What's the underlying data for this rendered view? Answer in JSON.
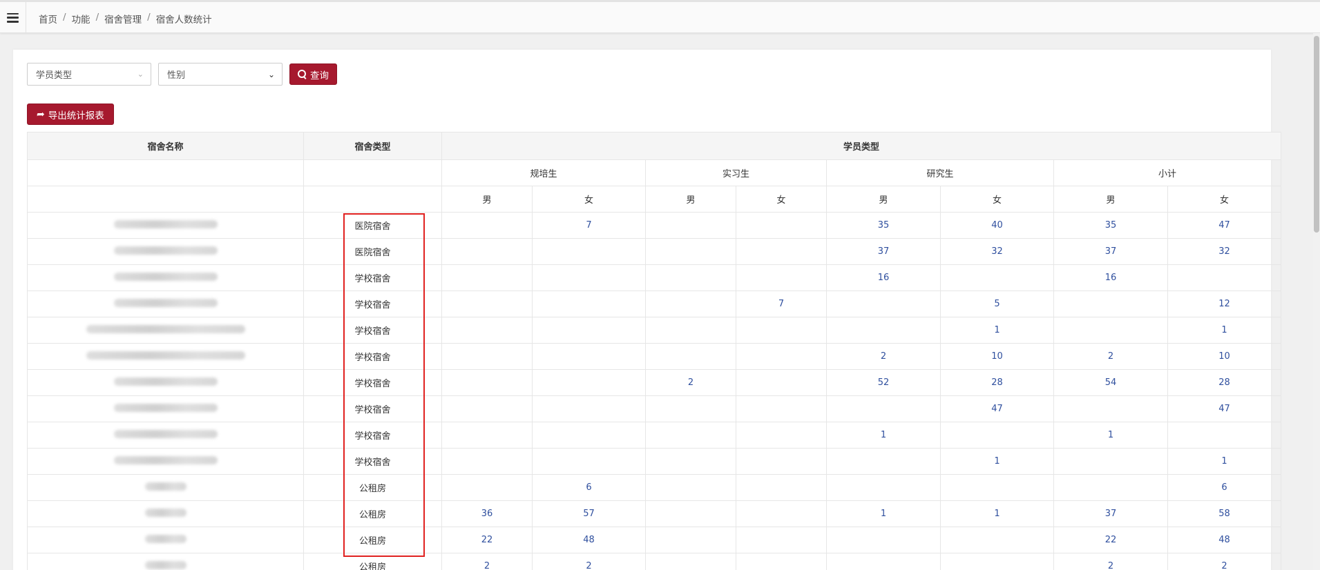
{
  "breadcrumb": [
    "首页",
    "功能",
    "宿舍管理",
    "宿舍人数统计"
  ],
  "filters": {
    "student_type_placeholder": "学员类型",
    "gender_placeholder": "性别",
    "search_label": "查询"
  },
  "export_label": "导出统计报表",
  "table": {
    "header": {
      "name": "宿舍名称",
      "dtype": "宿舍类型",
      "student_type": "学员类型"
    },
    "groups": [
      "规培生",
      "实习生",
      "研究生",
      "小计"
    ],
    "subcols": [
      "男",
      "女",
      "男",
      "女",
      "男",
      "女",
      "男",
      "女"
    ],
    "rows": [
      {
        "type": "医院宿舍",
        "v": [
          "",
          "7",
          "",
          "",
          "35",
          "40",
          "35",
          "47"
        ]
      },
      {
        "type": "医院宿舍",
        "v": [
          "",
          "",
          "",
          "",
          "37",
          "32",
          "37",
          "32"
        ]
      },
      {
        "type": "学校宿舍",
        "v": [
          "",
          "",
          "",
          "",
          "16",
          "",
          "16",
          ""
        ]
      },
      {
        "type": "学校宿舍",
        "v": [
          "",
          "",
          "",
          "7",
          "",
          "5",
          "",
          "12"
        ]
      },
      {
        "type": "学校宿舍",
        "v": [
          "",
          "",
          "",
          "",
          "",
          "1",
          "",
          "1"
        ]
      },
      {
        "type": "学校宿舍",
        "v": [
          "",
          "",
          "",
          "",
          "2",
          "10",
          "2",
          "10"
        ]
      },
      {
        "type": "学校宿舍",
        "v": [
          "",
          "",
          "2",
          "",
          "52",
          "28",
          "54",
          "28"
        ]
      },
      {
        "type": "学校宿舍",
        "v": [
          "",
          "",
          "",
          "",
          "",
          "47",
          "",
          "47"
        ]
      },
      {
        "type": "学校宿舍",
        "v": [
          "",
          "",
          "",
          "",
          "1",
          "",
          "1",
          ""
        ]
      },
      {
        "type": "学校宿舍",
        "v": [
          "",
          "",
          "",
          "",
          "",
          "1",
          "",
          "1"
        ]
      },
      {
        "type": "公租房",
        "v": [
          "",
          "6",
          "",
          "",
          "",
          "",
          "",
          "6"
        ]
      },
      {
        "type": "公租房",
        "v": [
          "36",
          "57",
          "",
          "",
          "1",
          "1",
          "37",
          "58"
        ]
      },
      {
        "type": "公租房",
        "v": [
          "22",
          "48",
          "",
          "",
          "",
          "",
          "22",
          "48"
        ]
      },
      {
        "type": "公租房",
        "v": [
          "2",
          "2",
          "",
          "",
          "",
          "",
          "2",
          "2"
        ]
      }
    ]
  },
  "colors": {
    "primary": "#a6192e",
    "value_blue": "#2f4f9e",
    "highlight_red": "#e0201f"
  }
}
